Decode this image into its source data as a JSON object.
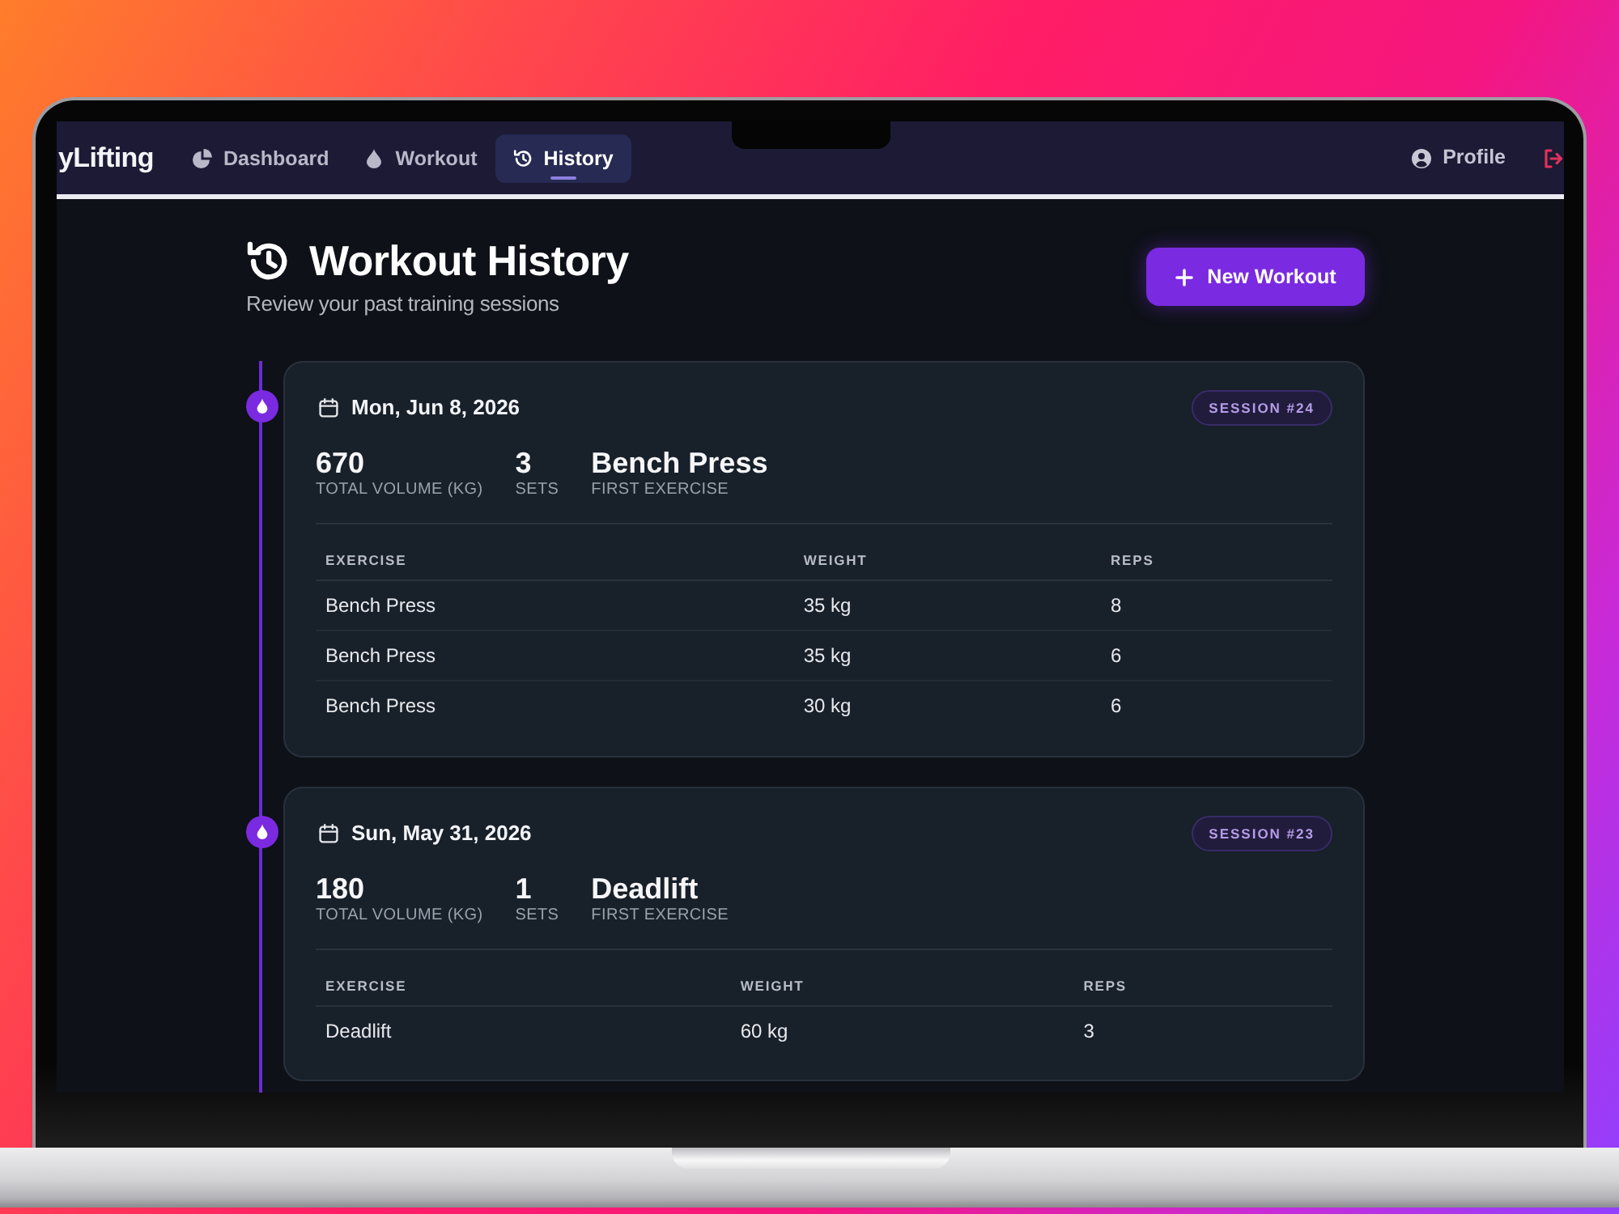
{
  "navbar": {
    "brand": "yLifting",
    "items": [
      {
        "label": "Dashboard",
        "selected": false
      },
      {
        "label": "Workout",
        "selected": false
      },
      {
        "label": "History",
        "selected": true
      }
    ],
    "profile": "Profile"
  },
  "header": {
    "title": "Workout History",
    "subtitle": "Review your past training sessions",
    "new_button": "New Workout"
  },
  "sessions": [
    {
      "date": "Mon, Jun 8, 2026",
      "badge": "SESSION #24",
      "stats": [
        {
          "value": "670",
          "label": "TOTAL VOLUME (KG)"
        },
        {
          "value": "3",
          "label": "SETS"
        },
        {
          "value": "Bench Press",
          "label": "FIRST EXERCISE"
        }
      ],
      "table": {
        "columns": [
          "EXERCISE",
          "WEIGHT",
          "REPS"
        ],
        "rows": [
          [
            "Bench Press",
            "35 kg",
            "8"
          ],
          [
            "Bench Press",
            "35 kg",
            "6"
          ],
          [
            "Bench Press",
            "30 kg",
            "6"
          ]
        ]
      }
    },
    {
      "date": "Sun, May 31, 2026",
      "badge": "SESSION #23",
      "stats": [
        {
          "value": "180",
          "label": "TOTAL VOLUME (KG)"
        },
        {
          "value": "1",
          "label": "SETS"
        },
        {
          "value": "Deadlift",
          "label": "FIRST EXERCISE"
        }
      ],
      "table": {
        "columns": [
          "EXERCISE",
          "WEIGHT",
          "REPS"
        ],
        "rows": [
          [
            "Deadlift",
            "60 kg",
            "3"
          ]
        ]
      }
    }
  ]
}
